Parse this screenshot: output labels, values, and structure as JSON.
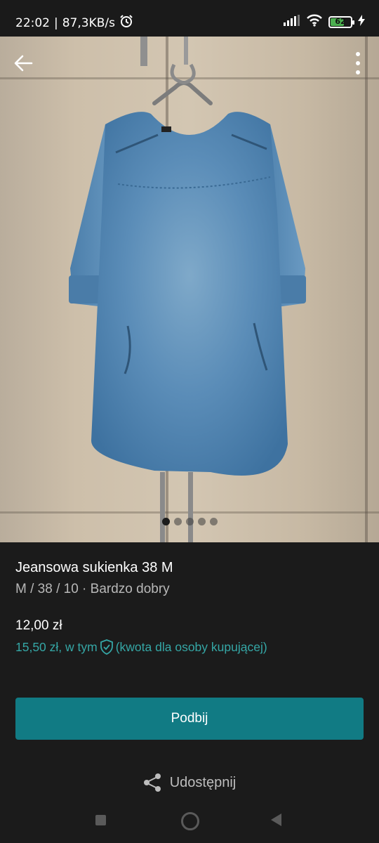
{
  "status_bar": {
    "time": "22:02",
    "network_speed": "87,3KB/s",
    "battery_level": "62",
    "icons": [
      "alarm-icon",
      "signal-icon",
      "wifi-icon",
      "battery-icon",
      "charging-icon"
    ]
  },
  "gallery": {
    "image_count": 5,
    "active_index": 0,
    "image_description_icon": "denim-dress-photo"
  },
  "item": {
    "title": "Jeansowa sukienka 38 M",
    "details": "M / 38 / 10 · Bardzo dobry",
    "price": "12,00 zł",
    "buyer_price_prefix": "15,50 zł, w tym",
    "buyer_price_suffix": "(kwota dla osoby kupującej)"
  },
  "actions": {
    "bump_label": "Podbij",
    "share_label": "Udostępnij"
  },
  "colors": {
    "accent": "#117b84",
    "link": "#35a7a6",
    "background": "#1b1b1b"
  }
}
